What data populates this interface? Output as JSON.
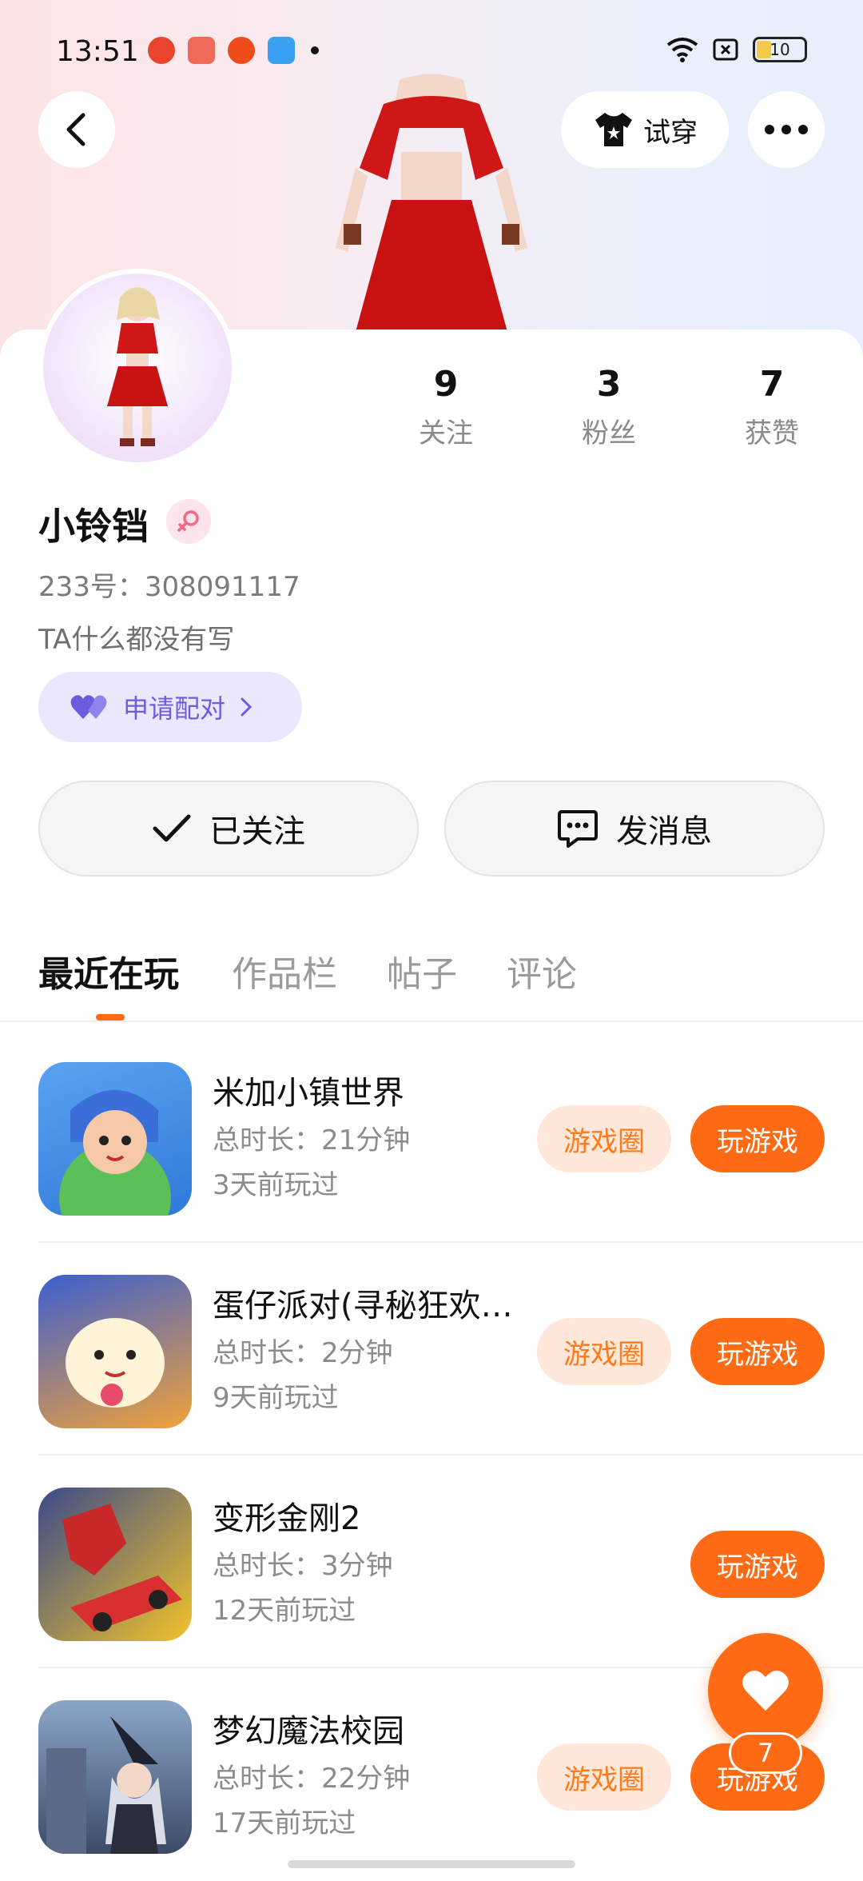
{
  "status_bar": {
    "time": "13:51",
    "battery": "10"
  },
  "header": {
    "try_on_label": "试穿"
  },
  "profile": {
    "stats": [
      {
        "value": "9",
        "label": "关注"
      },
      {
        "value": "3",
        "label": "粉丝"
      },
      {
        "value": "7",
        "label": "获赞"
      }
    ],
    "name": "小铃铛",
    "uid": "233号：308091117",
    "bio": "TA什么都没有写",
    "pair_label": "申请配对"
  },
  "actions": {
    "follow_label": "已关注",
    "message_label": "发消息"
  },
  "tabs": [
    "最近在玩",
    "作品栏",
    "帖子",
    "评论"
  ],
  "games": [
    {
      "title": "米加小镇世界",
      "duration": "总时长：21分钟",
      "last_played": "3天前玩过",
      "circle_label": "游戏圈",
      "play_label": "玩游戏"
    },
    {
      "title": "蛋仔派对(寻秘狂欢…",
      "duration": "总时长：2分钟",
      "last_played": "9天前玩过",
      "circle_label": "游戏圈",
      "play_label": "玩游戏"
    },
    {
      "title": "变形金刚2",
      "duration": "总时长：3分钟",
      "last_played": "12天前玩过",
      "circle_label": "",
      "play_label": "玩游戏"
    },
    {
      "title": "梦幻魔法校园",
      "duration": "总时长：22分钟",
      "last_played": "17天前玩过",
      "circle_label": "游戏圈",
      "play_label": "玩游戏"
    }
  ],
  "fab": {
    "badge": "7"
  },
  "colors": {
    "accent": "#ff6a14",
    "pair_bg": "#ebe8fd",
    "pair_text": "#6c5de0"
  }
}
